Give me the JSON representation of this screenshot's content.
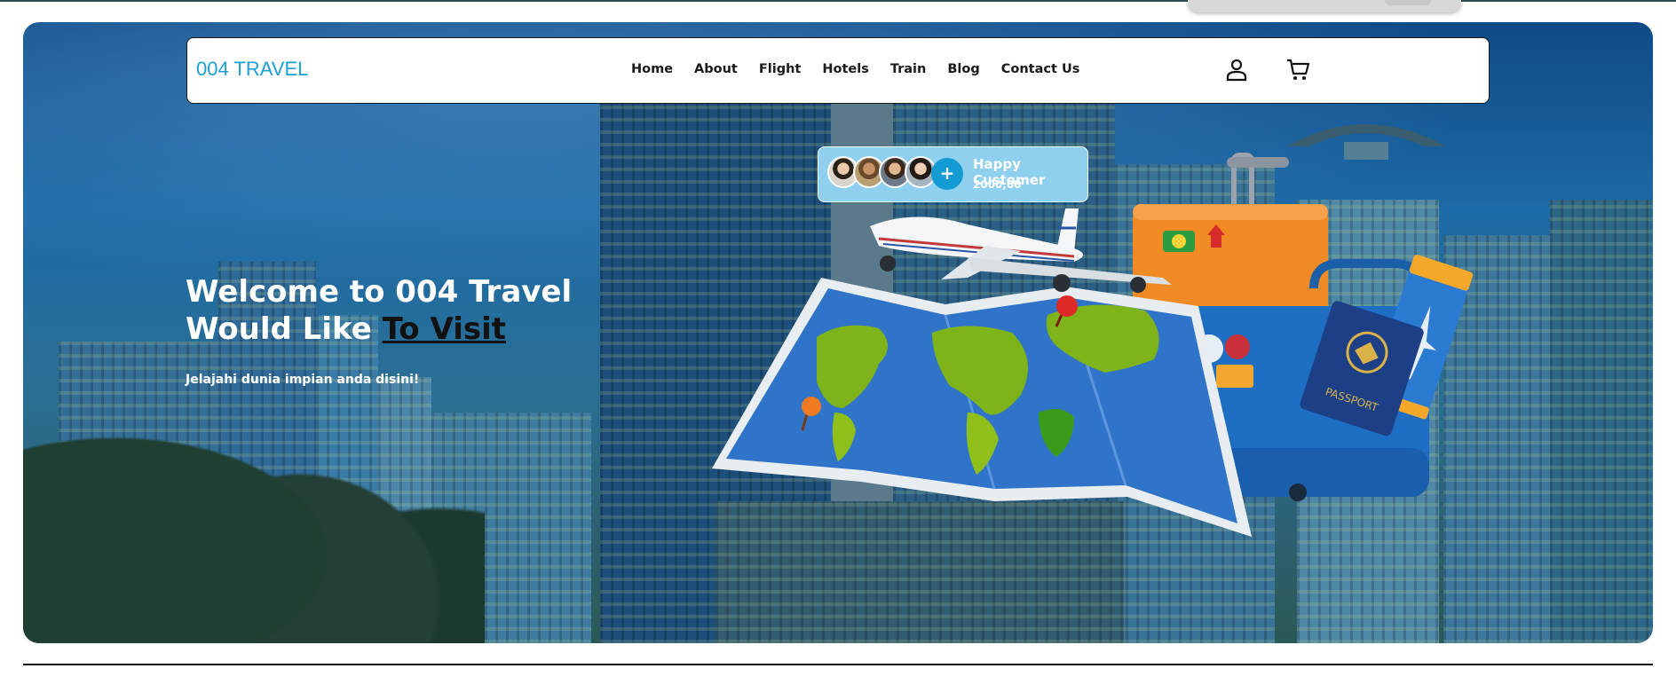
{
  "brand": {
    "name": "004 TRAVEL"
  },
  "nav": {
    "links": [
      "Home",
      "About",
      "Flight",
      "Hotels",
      "Train",
      "Blog",
      "Contact Us"
    ],
    "icons": [
      "user-icon",
      "cart-icon"
    ]
  },
  "hero": {
    "title_line1": "Welcome to 004 Travel",
    "title_line2_prefix": "Would Like ",
    "title_line2_highlight": "To Visit",
    "subtitle": "Jelajahi dunia impian anda disini!"
  },
  "customers": {
    "label": "Happy Customer",
    "count": "2000,00",
    "plus": "+"
  },
  "illustration": {
    "passport_text": "PASSPORT"
  },
  "colors": {
    "brand": "#1aa0d6",
    "card_bg": "#8ed0ee",
    "plus_button": "#139bd3"
  }
}
